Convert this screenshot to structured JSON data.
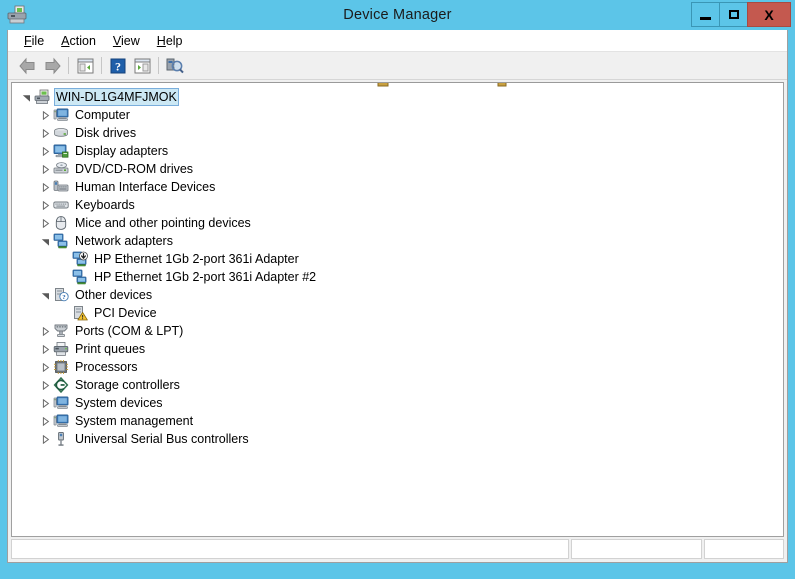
{
  "window": {
    "title": "Device Manager",
    "icon": "device-manager-icon",
    "frame_color": "#5CC5E8",
    "close_button_color": "#c4594f",
    "caption_buttons": [
      {
        "name": "minimize-button",
        "label": "–"
      },
      {
        "name": "maximize-button",
        "label": "□"
      },
      {
        "name": "close-button",
        "label": "X"
      }
    ]
  },
  "menubar": {
    "items": [
      {
        "name": "menu-file",
        "accel": "F",
        "rest": "ile"
      },
      {
        "name": "menu-action",
        "accel": "A",
        "rest": "ction"
      },
      {
        "name": "menu-view",
        "accel": "V",
        "rest": "iew"
      },
      {
        "name": "menu-help",
        "accel": "H",
        "rest": "elp"
      }
    ]
  },
  "toolbar": {
    "buttons": [
      {
        "name": "back-button",
        "icon": "back-arrow-icon",
        "tooltip": "Back"
      },
      {
        "name": "forward-button",
        "icon": "forward-arrow-icon",
        "tooltip": "Forward"
      },
      {
        "name": "show-hide-console-tree-button",
        "icon": "console-tree-icon",
        "tooltip": "Show/Hide Console Tree"
      },
      {
        "name": "help-button",
        "icon": "help-question-icon",
        "tooltip": "Help"
      },
      {
        "name": "properties-button",
        "icon": "properties-panel-icon",
        "tooltip": "Properties"
      },
      {
        "name": "scan-hardware-changes-button",
        "icon": "scan-hardware-icon",
        "tooltip": "Scan for hardware changes"
      }
    ]
  },
  "tree": {
    "root": {
      "label": "WIN-DL1G4MFJMOK",
      "icon": "computer-root-icon",
      "expanded": true,
      "selected": true,
      "level": 0
    },
    "nodes": [
      {
        "label": "Computer",
        "icon": "computer-icon",
        "expanded": false,
        "leaf": false,
        "level": 1
      },
      {
        "label": "Disk drives",
        "icon": "disk-drive-icon",
        "expanded": false,
        "leaf": false,
        "level": 1
      },
      {
        "label": "Display adapters",
        "icon": "display-adapter-icon",
        "expanded": false,
        "leaf": false,
        "level": 1
      },
      {
        "label": "DVD/CD-ROM drives",
        "icon": "dvd-drive-icon",
        "expanded": false,
        "leaf": false,
        "level": 1
      },
      {
        "label": "Human Interface Devices",
        "icon": "hid-icon",
        "expanded": false,
        "leaf": false,
        "level": 1
      },
      {
        "label": "Keyboards",
        "icon": "keyboard-icon",
        "expanded": false,
        "leaf": false,
        "level": 1
      },
      {
        "label": "Mice and other pointing devices",
        "icon": "mouse-icon",
        "expanded": false,
        "leaf": false,
        "level": 1
      },
      {
        "label": "Network adapters",
        "icon": "network-adapter-icon",
        "expanded": true,
        "leaf": false,
        "level": 1
      },
      {
        "label": "HP Ethernet 1Gb 2-port 361i Adapter",
        "icon": "network-adapter-disabled-icon",
        "leaf": true,
        "level": 2
      },
      {
        "label": "HP Ethernet 1Gb 2-port 361i Adapter #2",
        "icon": "network-adapter-icon",
        "leaf": true,
        "level": 2
      },
      {
        "label": "Other devices",
        "icon": "unknown-device-icon",
        "expanded": true,
        "leaf": false,
        "level": 1
      },
      {
        "label": "PCI Device",
        "icon": "warning-device-icon",
        "leaf": true,
        "level": 2
      },
      {
        "label": "Ports (COM & LPT)",
        "icon": "port-icon",
        "expanded": false,
        "leaf": false,
        "level": 1
      },
      {
        "label": "Print queues",
        "icon": "printer-icon",
        "expanded": false,
        "leaf": false,
        "level": 1
      },
      {
        "label": "Processors",
        "icon": "processor-icon",
        "expanded": false,
        "leaf": false,
        "level": 1
      },
      {
        "label": "Storage controllers",
        "icon": "storage-controller-icon",
        "expanded": false,
        "leaf": false,
        "level": 1
      },
      {
        "label": "System devices",
        "icon": "system-device-icon",
        "expanded": false,
        "leaf": false,
        "level": 1
      },
      {
        "label": "System management",
        "icon": "system-device-icon",
        "expanded": false,
        "leaf": false,
        "level": 1
      },
      {
        "label": "Universal Serial Bus controllers",
        "icon": "usb-controller-icon",
        "expanded": false,
        "leaf": false,
        "level": 1
      }
    ]
  },
  "statusbar": {
    "panes": [
      {
        "name": "status-pane-main",
        "text": ""
      },
      {
        "name": "status-pane-second",
        "text": ""
      },
      {
        "name": "status-pane-third",
        "text": ""
      }
    ]
  }
}
